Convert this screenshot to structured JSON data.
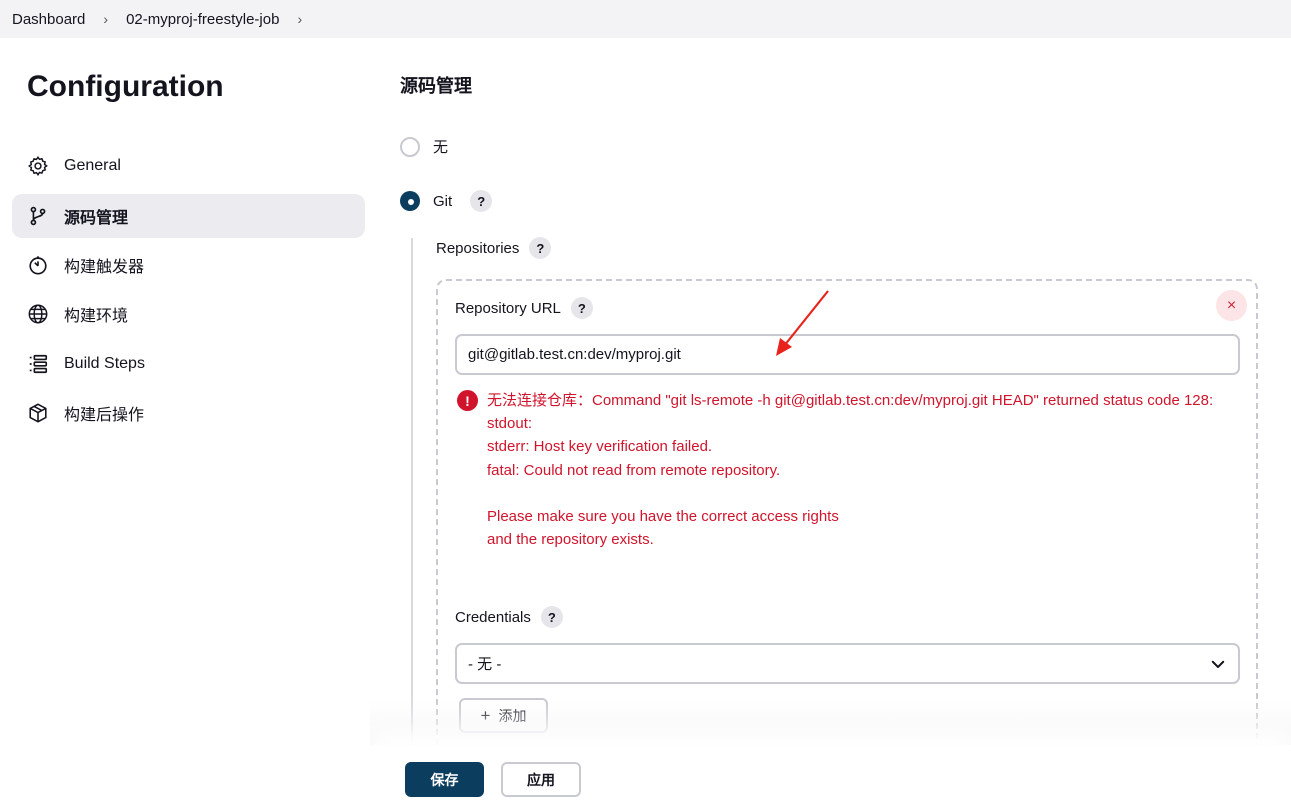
{
  "breadcrumb": {
    "items": [
      "Dashboard",
      "02-myproj-freestyle-job"
    ],
    "separator": "›"
  },
  "sidebar": {
    "title": "Configuration",
    "items": [
      {
        "label": "General",
        "icon": "gear-icon"
      },
      {
        "label": "源码管理",
        "icon": "branch-icon",
        "active": true
      },
      {
        "label": "构建触发器",
        "icon": "timer-icon"
      },
      {
        "label": "构建环境",
        "icon": "globe-icon"
      },
      {
        "label": "Build Steps",
        "icon": "list-icon"
      },
      {
        "label": "构建后操作",
        "icon": "package-icon"
      }
    ]
  },
  "main": {
    "section_title": "源码管理",
    "scm_options": [
      {
        "label": "无",
        "selected": false
      },
      {
        "label": "Git",
        "selected": true
      }
    ],
    "help_glyph": "?",
    "repositories_label": "Repositories",
    "repository_url_label": "Repository URL",
    "repository_url_value": "git@gitlab.test.cn:dev/myproj.git",
    "remove_glyph": "×",
    "error_glyph": "!",
    "error_message": "无法连接仓库：Command \"git ls-remote -h git@gitlab.test.cn:dev/myproj.git HEAD\" returned status code 128:\nstdout:\nstderr: Host key verification failed.\nfatal: Could not read from remote repository.\n\nPlease make sure you have the correct access rights\nand the repository exists.",
    "credentials_label": "Credentials",
    "credentials_selected": "- 无 -",
    "add_button": {
      "glyph": "+",
      "label": "添加"
    }
  },
  "footer": {
    "save_label": "保存",
    "apply_label": "应用"
  },
  "colors": {
    "primary": "#0b3d5e",
    "error": "#d0142c",
    "annotation_arrow": "#e8231c"
  }
}
